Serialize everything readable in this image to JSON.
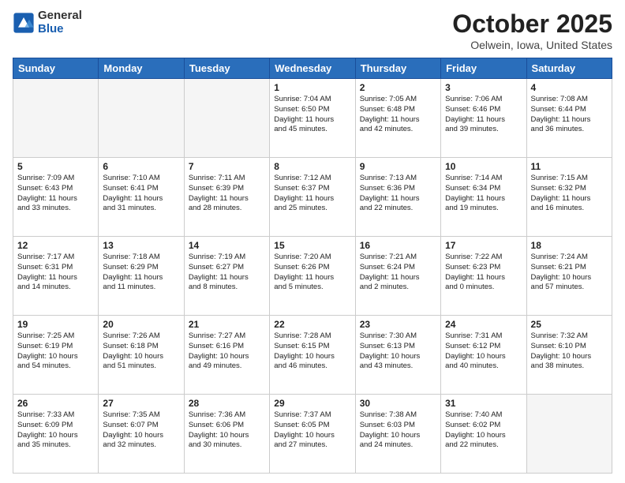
{
  "logo": {
    "general": "General",
    "blue": "Blue"
  },
  "title": {
    "month": "October 2025",
    "location": "Oelwein, Iowa, United States"
  },
  "headers": [
    "Sunday",
    "Monday",
    "Tuesday",
    "Wednesday",
    "Thursday",
    "Friday",
    "Saturday"
  ],
  "weeks": [
    [
      {
        "num": "",
        "info": ""
      },
      {
        "num": "",
        "info": ""
      },
      {
        "num": "",
        "info": ""
      },
      {
        "num": "1",
        "info": "Sunrise: 7:04 AM\nSunset: 6:50 PM\nDaylight: 11 hours\nand 45 minutes."
      },
      {
        "num": "2",
        "info": "Sunrise: 7:05 AM\nSunset: 6:48 PM\nDaylight: 11 hours\nand 42 minutes."
      },
      {
        "num": "3",
        "info": "Sunrise: 7:06 AM\nSunset: 6:46 PM\nDaylight: 11 hours\nand 39 minutes."
      },
      {
        "num": "4",
        "info": "Sunrise: 7:08 AM\nSunset: 6:44 PM\nDaylight: 11 hours\nand 36 minutes."
      }
    ],
    [
      {
        "num": "5",
        "info": "Sunrise: 7:09 AM\nSunset: 6:43 PM\nDaylight: 11 hours\nand 33 minutes."
      },
      {
        "num": "6",
        "info": "Sunrise: 7:10 AM\nSunset: 6:41 PM\nDaylight: 11 hours\nand 31 minutes."
      },
      {
        "num": "7",
        "info": "Sunrise: 7:11 AM\nSunset: 6:39 PM\nDaylight: 11 hours\nand 28 minutes."
      },
      {
        "num": "8",
        "info": "Sunrise: 7:12 AM\nSunset: 6:37 PM\nDaylight: 11 hours\nand 25 minutes."
      },
      {
        "num": "9",
        "info": "Sunrise: 7:13 AM\nSunset: 6:36 PM\nDaylight: 11 hours\nand 22 minutes."
      },
      {
        "num": "10",
        "info": "Sunrise: 7:14 AM\nSunset: 6:34 PM\nDaylight: 11 hours\nand 19 minutes."
      },
      {
        "num": "11",
        "info": "Sunrise: 7:15 AM\nSunset: 6:32 PM\nDaylight: 11 hours\nand 16 minutes."
      }
    ],
    [
      {
        "num": "12",
        "info": "Sunrise: 7:17 AM\nSunset: 6:31 PM\nDaylight: 11 hours\nand 14 minutes."
      },
      {
        "num": "13",
        "info": "Sunrise: 7:18 AM\nSunset: 6:29 PM\nDaylight: 11 hours\nand 11 minutes."
      },
      {
        "num": "14",
        "info": "Sunrise: 7:19 AM\nSunset: 6:27 PM\nDaylight: 11 hours\nand 8 minutes."
      },
      {
        "num": "15",
        "info": "Sunrise: 7:20 AM\nSunset: 6:26 PM\nDaylight: 11 hours\nand 5 minutes."
      },
      {
        "num": "16",
        "info": "Sunrise: 7:21 AM\nSunset: 6:24 PM\nDaylight: 11 hours\nand 2 minutes."
      },
      {
        "num": "17",
        "info": "Sunrise: 7:22 AM\nSunset: 6:23 PM\nDaylight: 11 hours\nand 0 minutes."
      },
      {
        "num": "18",
        "info": "Sunrise: 7:24 AM\nSunset: 6:21 PM\nDaylight: 10 hours\nand 57 minutes."
      }
    ],
    [
      {
        "num": "19",
        "info": "Sunrise: 7:25 AM\nSunset: 6:19 PM\nDaylight: 10 hours\nand 54 minutes."
      },
      {
        "num": "20",
        "info": "Sunrise: 7:26 AM\nSunset: 6:18 PM\nDaylight: 10 hours\nand 51 minutes."
      },
      {
        "num": "21",
        "info": "Sunrise: 7:27 AM\nSunset: 6:16 PM\nDaylight: 10 hours\nand 49 minutes."
      },
      {
        "num": "22",
        "info": "Sunrise: 7:28 AM\nSunset: 6:15 PM\nDaylight: 10 hours\nand 46 minutes."
      },
      {
        "num": "23",
        "info": "Sunrise: 7:30 AM\nSunset: 6:13 PM\nDaylight: 10 hours\nand 43 minutes."
      },
      {
        "num": "24",
        "info": "Sunrise: 7:31 AM\nSunset: 6:12 PM\nDaylight: 10 hours\nand 40 minutes."
      },
      {
        "num": "25",
        "info": "Sunrise: 7:32 AM\nSunset: 6:10 PM\nDaylight: 10 hours\nand 38 minutes."
      }
    ],
    [
      {
        "num": "26",
        "info": "Sunrise: 7:33 AM\nSunset: 6:09 PM\nDaylight: 10 hours\nand 35 minutes."
      },
      {
        "num": "27",
        "info": "Sunrise: 7:35 AM\nSunset: 6:07 PM\nDaylight: 10 hours\nand 32 minutes."
      },
      {
        "num": "28",
        "info": "Sunrise: 7:36 AM\nSunset: 6:06 PM\nDaylight: 10 hours\nand 30 minutes."
      },
      {
        "num": "29",
        "info": "Sunrise: 7:37 AM\nSunset: 6:05 PM\nDaylight: 10 hours\nand 27 minutes."
      },
      {
        "num": "30",
        "info": "Sunrise: 7:38 AM\nSunset: 6:03 PM\nDaylight: 10 hours\nand 24 minutes."
      },
      {
        "num": "31",
        "info": "Sunrise: 7:40 AM\nSunset: 6:02 PM\nDaylight: 10 hours\nand 22 minutes."
      },
      {
        "num": "",
        "info": ""
      }
    ]
  ]
}
